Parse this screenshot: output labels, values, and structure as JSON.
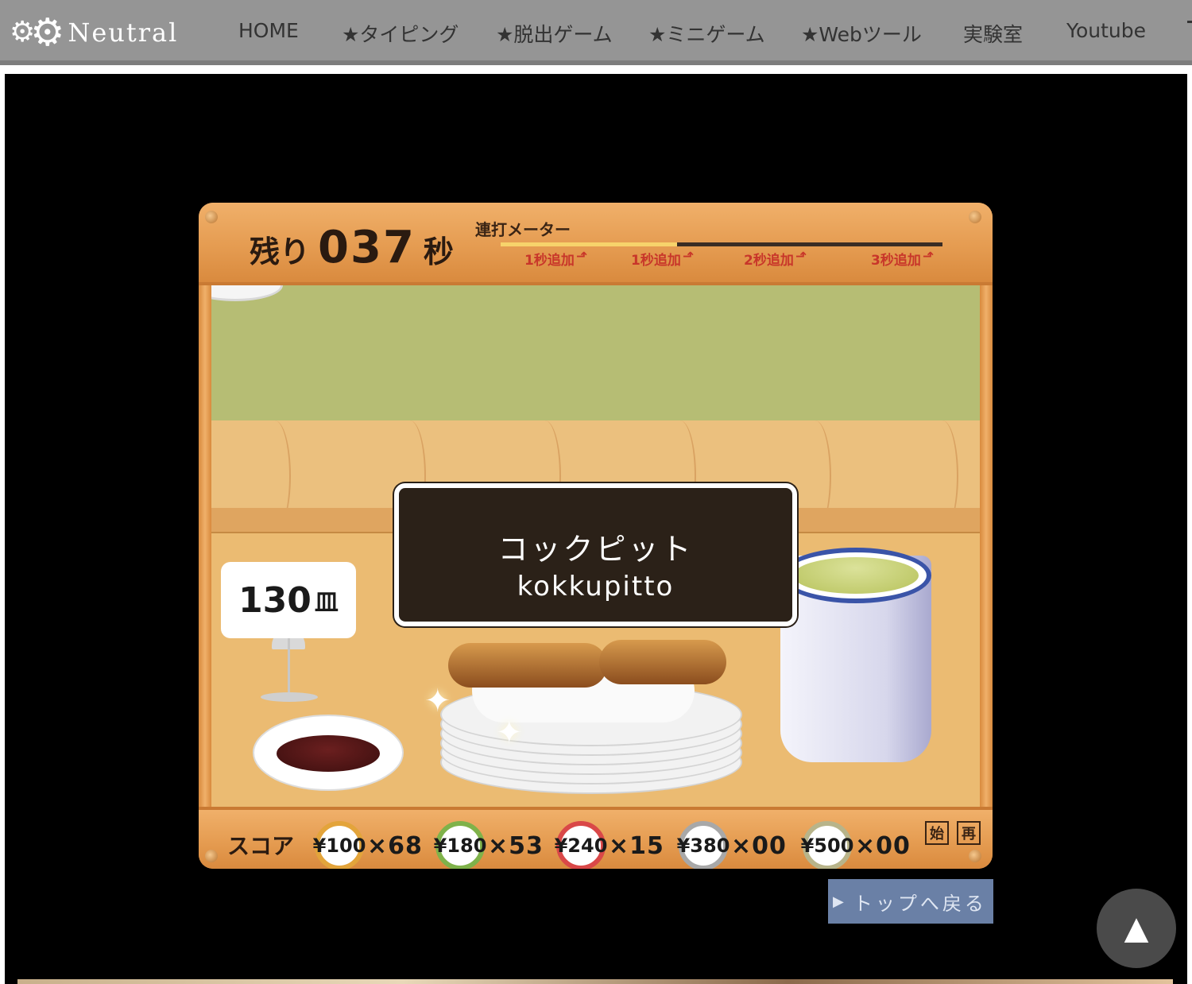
{
  "site": {
    "logo_text": "Neutral",
    "logo_icon": "gear-icon"
  },
  "nav": {
    "items": [
      {
        "label": "HOME"
      },
      {
        "label": "★タイピング"
      },
      {
        "label": "★脱出ゲーム"
      },
      {
        "label": "★ミニゲーム"
      },
      {
        "label": "★Webツール"
      },
      {
        "label": "実験室"
      },
      {
        "label": "Youtube"
      }
    ]
  },
  "game": {
    "timer": {
      "prefix": "残り",
      "value": "037",
      "suffix": "秒"
    },
    "combo_meter": {
      "label": "連打メーター",
      "fill_fraction": 0.4,
      "marks": [
        "1秒追加",
        "1秒追加",
        "2秒追加",
        "3秒追加"
      ],
      "colors": {
        "fill": "#f7d36b",
        "mark": "#c8362a"
      }
    },
    "plate_count": {
      "value": "130",
      "unit": "皿"
    },
    "word": {
      "kana": "コックピット",
      "romaji": "kokkupitto"
    },
    "score": {
      "label": "スコア",
      "items": [
        {
          "price": "¥100",
          "count": "×68",
          "color": "#e3a43b"
        },
        {
          "price": "¥180",
          "count": "×53",
          "color": "#7fb24a"
        },
        {
          "price": "¥240",
          "count": "×15",
          "color": "#d94848"
        },
        {
          "price": "¥380",
          "count": "×00",
          "color": "#a8a8a8"
        },
        {
          "price": "¥500",
          "count": "×00",
          "color": "#b8b48a"
        }
      ],
      "stamps": [
        "始",
        "再"
      ]
    }
  },
  "back_to_top": {
    "label": "トップへ戻る",
    "icon": "play-triangle-icon"
  },
  "scroll_top": {
    "label": "▲"
  }
}
